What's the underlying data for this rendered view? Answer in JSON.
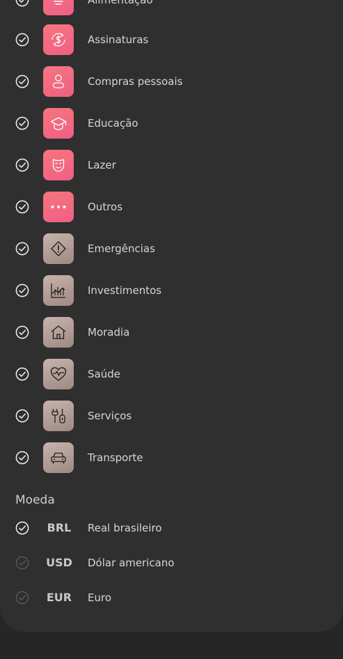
{
  "categories": [
    {
      "label": "Alimentação",
      "icon": "food-icon",
      "color": "#f36a80",
      "checked": true
    },
    {
      "label": "Assinaturas",
      "icon": "subscription-dollar-icon",
      "color": "#f36a80",
      "checked": true
    },
    {
      "label": "Compras pessoais",
      "icon": "person-icon",
      "color": "#f36a80",
      "checked": true
    },
    {
      "label": "Educação",
      "icon": "graduation-cap-icon",
      "color": "#f36a80",
      "checked": true
    },
    {
      "label": "Lazer",
      "icon": "theater-mask-icon",
      "color": "#f36a80",
      "checked": true
    },
    {
      "label": "Outros",
      "icon": "more-dots-icon",
      "color": "#f36a80",
      "checked": true
    },
    {
      "label": "Emergências",
      "icon": "warning-diamond-icon",
      "color": "#b39e97",
      "checked": true
    },
    {
      "label": "Investimentos",
      "icon": "chart-trend-icon",
      "color": "#b39e97",
      "checked": true
    },
    {
      "label": "Moradia",
      "icon": "house-icon",
      "color": "#b39e97",
      "checked": true
    },
    {
      "label": "Saúde",
      "icon": "heart-pulse-icon",
      "color": "#b39e97",
      "checked": true
    },
    {
      "label": "Serviços",
      "icon": "tools-icon",
      "color": "#b39e97",
      "checked": true
    },
    {
      "label": "Transporte",
      "icon": "car-icon",
      "color": "#b39e97",
      "checked": true
    }
  ],
  "currency": {
    "title": "Moeda",
    "options": [
      {
        "code": "BRL",
        "label": "Real brasileiro",
        "checked": true
      },
      {
        "code": "USD",
        "label": "Dólar americano",
        "checked": false
      },
      {
        "code": "EUR",
        "label": "Euro",
        "checked": false
      }
    ]
  }
}
